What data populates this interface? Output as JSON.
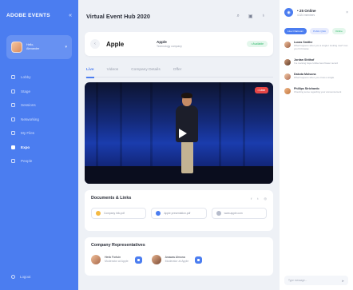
{
  "colors": {
    "primary": "#4b7df0",
    "live": "#e64646",
    "available": "#2fb86a"
  },
  "sidebar": {
    "logo": "ADOBE EVENTS",
    "user": {
      "greeting": "Hello,",
      "name": "Alexander"
    },
    "items": [
      {
        "label": "Lobby",
        "icon": "home-icon"
      },
      {
        "label": "Stage",
        "icon": "stage-icon"
      },
      {
        "label": "Sessions",
        "icon": "calendar-icon"
      },
      {
        "label": "Networking",
        "icon": "network-icon"
      },
      {
        "label": "My Files",
        "icon": "folder-icon"
      },
      {
        "label": "Expo",
        "icon": "grid-icon",
        "active": true
      },
      {
        "label": "People",
        "icon": "people-icon"
      }
    ],
    "logout": "Logout"
  },
  "header": {
    "title": "Virtual Event Hub 2020"
  },
  "sponsor": {
    "logo_text": " Apple",
    "name": "Apple",
    "subtitle": "Technology company",
    "status": "• Available"
  },
  "tabs": [
    "Live",
    "Videos",
    "Company Details",
    "Offer"
  ],
  "video": {
    "live_label": "• Live"
  },
  "documents": {
    "title": "Documents & Links",
    "items": [
      "Company info.pdf",
      "Apple presentation.pdf",
      "www.apple.com"
    ]
  },
  "reps": {
    "title": "Company Representatives",
    "items": [
      {
        "name": "Henk Fortuin",
        "role": "Moderator at Apple"
      },
      {
        "name": "Anawas Almona",
        "role": "Moderator at Apple"
      }
    ]
  },
  "chat": {
    "online": "• 25 Online",
    "online_sub": "4.324 members",
    "filters": [
      "Live Chatroom",
      "Public Q&A",
      "Online"
    ],
    "messages": [
      {
        "name": "Lucas Smithe",
        "text": "What happens when you a single I looking now? can you hit browse"
      },
      {
        "name": "Jordan Shithof",
        "text": "I've revising hope Unlike best flower record"
      },
      {
        "name": "Dakota Molsona",
        "text": "What happens when you cross a single"
      },
      {
        "name": "Phillips Strichardo",
        "text": "Checking some regarding your announcement"
      }
    ],
    "input_placeholder": "Type message..."
  }
}
